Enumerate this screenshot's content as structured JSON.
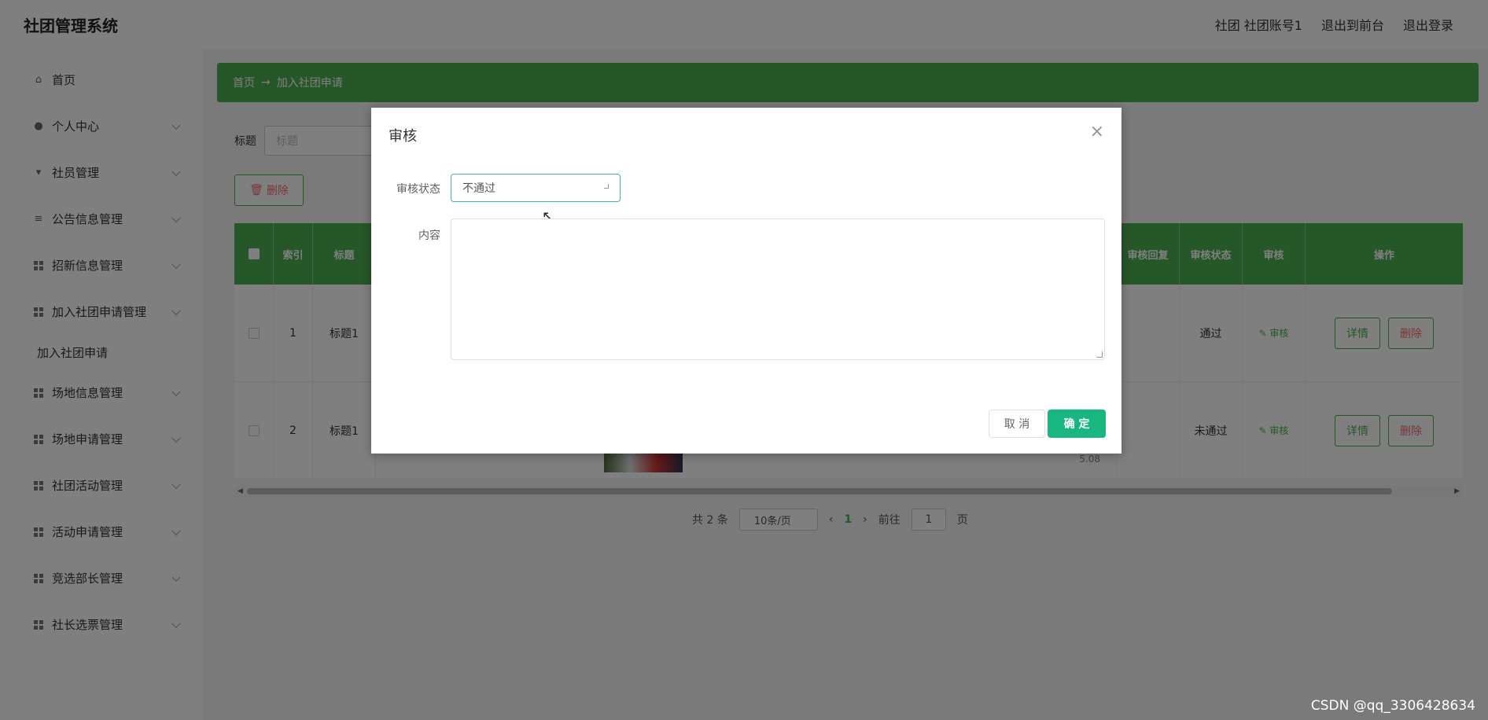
{
  "header": {
    "title": "社团管理系统",
    "user": "社团 社团账号1",
    "to_front": "退出到前台",
    "logout": "退出登录"
  },
  "sidebar": {
    "items": [
      {
        "label": "首页",
        "icon": "home-icon",
        "expandable": false
      },
      {
        "label": "个人中心",
        "icon": "user-icon",
        "expandable": true
      },
      {
        "label": "社员管理",
        "icon": "member-icon",
        "expandable": true
      },
      {
        "label": "公告信息管理",
        "icon": "list-icon",
        "expandable": true
      },
      {
        "label": "招新信息管理",
        "icon": "grid-icon",
        "expandable": true
      },
      {
        "label": "加入社团申请管理",
        "icon": "grid-icon",
        "expandable": true
      }
    ],
    "sub_item": "加入社团申请",
    "items2": [
      {
        "label": "场地信息管理",
        "icon": "grid-icon"
      },
      {
        "label": "场地申请管理",
        "icon": "grid-icon"
      },
      {
        "label": "社团活动管理",
        "icon": "grid-icon"
      },
      {
        "label": "活动申请管理",
        "icon": "grid-icon"
      },
      {
        "label": "竞选部长管理",
        "icon": "grid-icon"
      },
      {
        "label": "社长选票管理",
        "icon": "grid-icon"
      }
    ]
  },
  "breadcrumb": {
    "home": "首页",
    "arrow": "→",
    "current": "加入社团申请"
  },
  "search": {
    "label": "标题",
    "placeholder": "标题"
  },
  "toolbar": {
    "delete_label": "删除"
  },
  "table": {
    "headers": {
      "index": "索引",
      "title": "标题",
      "reply": "审核回复",
      "status": "审核状态",
      "audit": "审核",
      "ops": "操作"
    },
    "rows": [
      {
        "index": "1",
        "title": "标题1",
        "status": "通过",
        "audit": "审核",
        "detail": "详情",
        "delete": "删除"
      },
      {
        "index": "2",
        "title": "标题1",
        "status": "未通过",
        "audit": "审核",
        "detail": "详情",
        "delete": "删除"
      }
    ],
    "partial_text": "5.08"
  },
  "pager": {
    "total": "共 2 条",
    "page_size": "10条/页",
    "current_page": "1",
    "goto_label": "前往",
    "goto_value": "1",
    "page_suffix": "页"
  },
  "dialog": {
    "title": "审核",
    "status_label": "审核状态",
    "status_value": "不通过",
    "content_label": "内容",
    "cancel": "取 消",
    "confirm": "确 定"
  },
  "watermark": "CSDN @qq_3306428634",
  "colors": {
    "accent": "#4caf50",
    "confirm": "#19b67f",
    "danger": "#f56c6c"
  }
}
